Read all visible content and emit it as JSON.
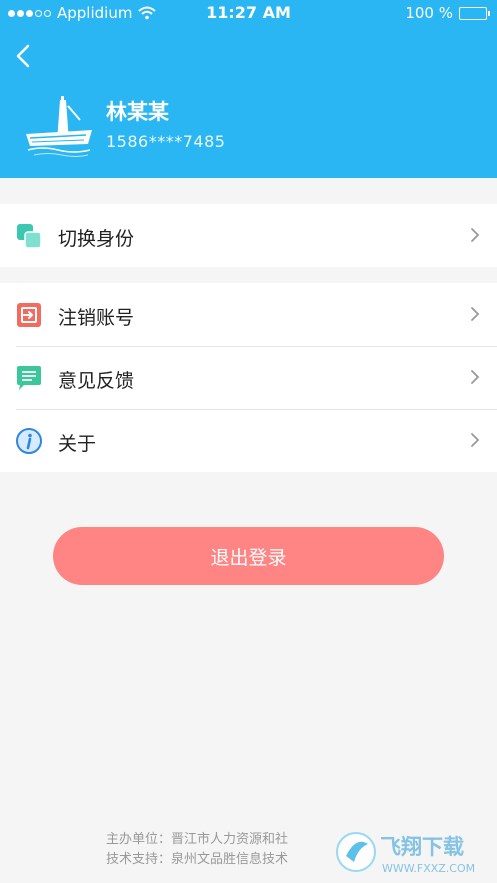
{
  "status_bar": {
    "carrier": "Applidium",
    "time": "11:27 AM",
    "battery": "100 %"
  },
  "profile": {
    "name": "林某某",
    "phone": "1586****7485"
  },
  "menu_group_1": [
    {
      "label": "切换身份",
      "icon": "switch-identity-icon"
    }
  ],
  "menu_group_2": [
    {
      "label": "注销账号",
      "icon": "cancel-account-icon"
    },
    {
      "label": "意见反馈",
      "icon": "feedback-icon"
    },
    {
      "label": "关于",
      "icon": "info-icon"
    }
  ],
  "logout_button": "退出登录",
  "footer": {
    "line1": "主办单位：晋江市人力资源和社",
    "line2": "技术支持：泉州文品胜信息技术"
  },
  "watermark": {
    "title": "飞翔下载",
    "url": "WWW.FXXZ.COM"
  },
  "colors": {
    "header": "#29b6f2",
    "logout": "#ff8585",
    "background": "#f5f5f5"
  }
}
